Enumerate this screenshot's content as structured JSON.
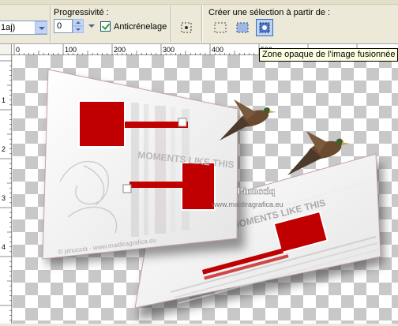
{
  "toolbar": {
    "mode_value": "1aj)",
    "progressivity_label": "Progressivité :",
    "progressivity_value": "0",
    "antialias_label": "Anticrénelage",
    "antialias_checked": true,
    "create_selection_label": "Créer une sélection à partir de :"
  },
  "tooltip": {
    "text": "Zone opaque de l'image fusionnée"
  },
  "ruler": {
    "h_ticks": [
      "0",
      "100",
      "200",
      "300",
      "400",
      "500"
    ],
    "v_ticks": [
      "1",
      "2",
      "3",
      "4"
    ]
  },
  "canvas": {
    "upper_card_text": "MOMENTS LIKE THIS",
    "lower_card_text": "MOMENTS LIKE THIS",
    "signature_name": "Pinucciq",
    "signature_url": "www.maidiragrafica.eu",
    "upper_card_watermark": "© pinuccia · www.maidiragrafica.eu",
    "accent_red": "#c00000"
  }
}
